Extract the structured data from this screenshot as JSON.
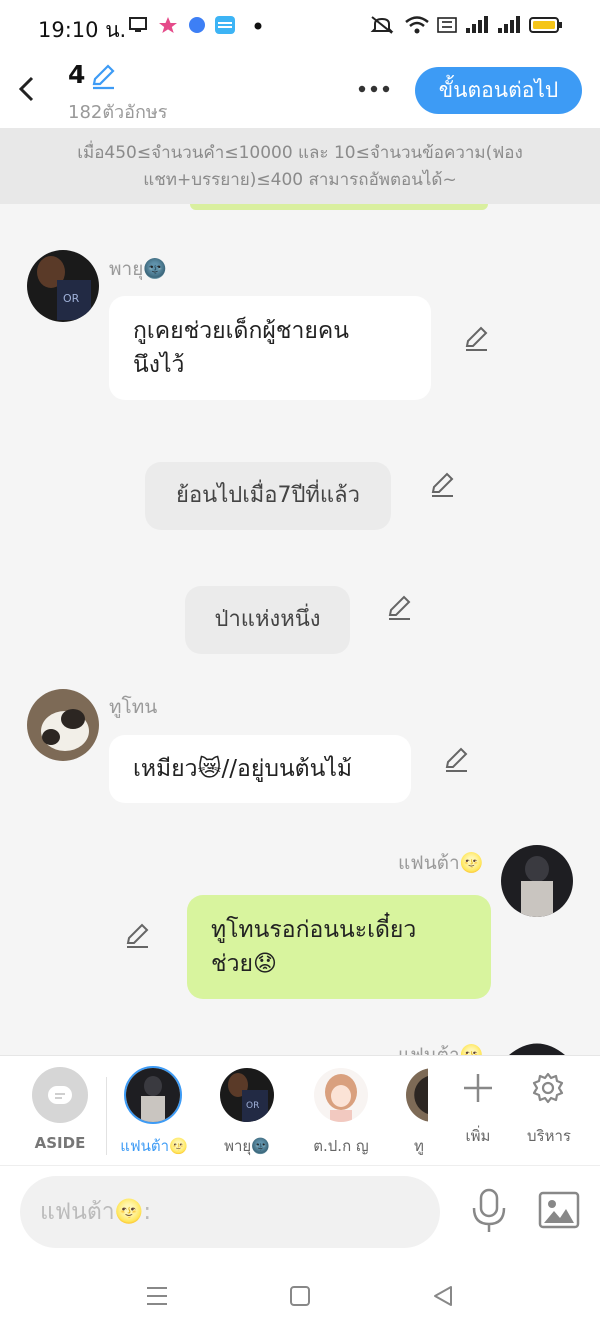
{
  "status_bar": {
    "time": "19:10 น."
  },
  "header": {
    "title": "4",
    "subtitle": "182ตัวอักษร",
    "next_button": "ขั้นตอนต่อไป"
  },
  "notice": {
    "line1": "เมื่อ450≤จำนวนคำ≤10000 และ 10≤จำนวนข้อความ(ฟอง",
    "line2": "แชท+บรรยาย)≤400 สามารถอัพตอนได้~"
  },
  "messages": [
    {
      "sender": "พายุ🌚",
      "text_line1": "กูเคยช่วยเด็กผู้ชายคน",
      "text_line2": "นึงไว้"
    },
    {
      "narration": "ย้อนไปเมื่อ7ปีที่แล้ว"
    },
    {
      "narration": "ป่าแห่งหนึ่ง"
    },
    {
      "sender": "ทูโทน",
      "text": "เหมียว😿//อยู่บนต้นไม้"
    },
    {
      "sender": "แฟนต้า🌝",
      "text_line1": "ทูโทนรอก่อนนะเดี๋ยว",
      "text_line2": "ช่วย😟"
    },
    {
      "sender": "แฟนต้า🌝"
    }
  ],
  "characters": [
    {
      "label": "ASIDE"
    },
    {
      "label": "แฟนต้า🌝"
    },
    {
      "label": "พายุ🌚"
    },
    {
      "label": "ต.ป.ก ญ"
    },
    {
      "label": "ทู"
    }
  ],
  "actions": {
    "add_label": "เพิ่ม",
    "manage_label": "บริหาร"
  },
  "input": {
    "placeholder": "แฟนต้า🌝:"
  },
  "colors": {
    "accent_blue": "#3d9bf5",
    "my_bubble_green": "#d8f49e",
    "background": "#f5f5f5"
  }
}
